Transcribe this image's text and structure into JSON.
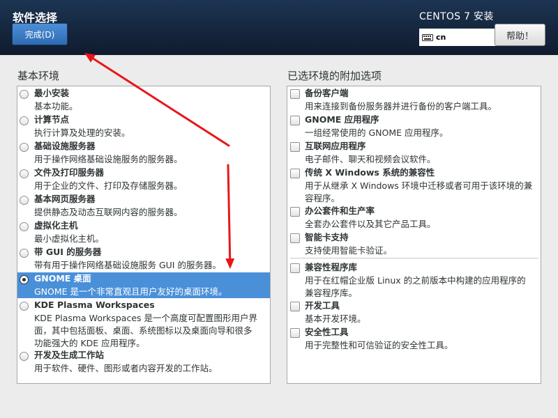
{
  "header": {
    "title": "软件选择",
    "done_label": "完成(D)",
    "product_title": "CENTOS 7 安装",
    "keyboard_layout": "cn",
    "help_label": "帮助！",
    "background_color": "#15263d",
    "accent_color": "#2e6bb5"
  },
  "base_environment": {
    "heading": "基本环境",
    "selected_index": 7,
    "items": [
      {
        "name": "最小安装",
        "desc": [
          "基本功能。"
        ],
        "checked": false
      },
      {
        "name": "计算节点",
        "desc": [
          "执行计算及处理的安装。"
        ],
        "checked": false
      },
      {
        "name": "基础设施服务器",
        "desc": [
          "用于操作网络基础设施服务的服务器。"
        ],
        "checked": false
      },
      {
        "name": "文件及打印服务器",
        "desc": [
          "用于企业的文件、打印及存储服务器。"
        ],
        "checked": false
      },
      {
        "name": "基本网页服务器",
        "desc": [
          "提供静态及动态互联网内容的服务器。"
        ],
        "checked": false
      },
      {
        "name": "虚拟化主机",
        "desc": [
          "最小虚拟化主机。"
        ],
        "checked": false
      },
      {
        "name": "带 GUI 的服务器",
        "desc": [
          "带有用于操作网络基础设施服务 GUI 的服务器。"
        ],
        "checked": false
      },
      {
        "name": "GNOME 桌面",
        "desc": [
          "GNOME 是一个非常直观且用户友好的桌面环境。"
        ],
        "checked": true
      },
      {
        "name": "KDE Plasma Workspaces",
        "desc": [
          "KDE Plasma Workspaces 是一个高度可配置图形用户界",
          "面，其中包括面板、桌面、系统图标以及桌面向导和很多",
          "功能强大的 KDE 应用程序。"
        ],
        "checked": false
      },
      {
        "name": "开发及生成工作站",
        "desc": [
          "用于软件、硬件、图形或者内容开发的工作站。"
        ],
        "checked": false
      }
    ]
  },
  "addons": {
    "heading": "已选环境的附加选项",
    "items": [
      {
        "name": "备份客户端",
        "desc": [
          "用来连接到备份服务器并进行备份的客户端工具。"
        ],
        "checked": false
      },
      {
        "name": "GNOME 应用程序",
        "desc": [
          "一组经常使用的 GNOME 应用程序。"
        ],
        "checked": false
      },
      {
        "name": "互联网应用程序",
        "desc": [
          "电子邮件、聊天和视频会议软件。"
        ],
        "checked": false
      },
      {
        "name": "传统 X Windows 系统的兼容性",
        "desc": [
          "用于从继承 X Windows 环境中迁移或者可用于该环境的兼",
          "容程序。"
        ],
        "checked": false
      },
      {
        "name": "办公套件和生产率",
        "desc": [
          "全套办公套件以及其它产品工具。"
        ],
        "checked": false
      },
      {
        "name": "智能卡支持",
        "desc": [
          "支持使用智能卡验证。"
        ],
        "checked": false
      },
      {
        "name": "兼容性程序库",
        "desc": [
          "用于在红帽企业版 Linux 的之前版本中构建的应用程序的",
          "兼容程序库。"
        ],
        "checked": false
      },
      {
        "name": "开发工具",
        "desc": [
          "基本开发环境。"
        ],
        "checked": false
      },
      {
        "name": "安全性工具",
        "desc": [
          "用于完整性和可信验证的安全性工具。"
        ],
        "checked": false
      }
    ]
  },
  "annotation_color": "#e8161b"
}
